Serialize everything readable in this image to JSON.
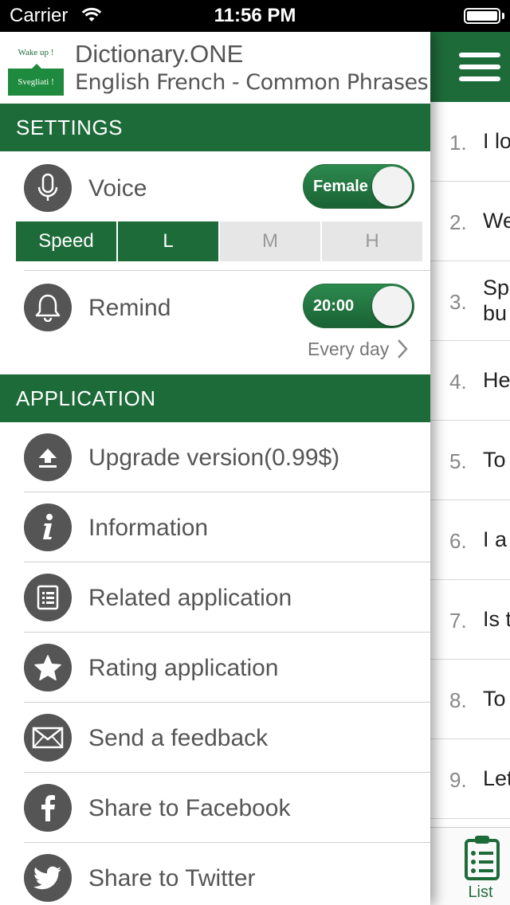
{
  "status_bar": {
    "carrier": "Carrier",
    "time": "11:56 PM"
  },
  "logo": {
    "top_text": "Wake up !",
    "bottom_text": "Svegliati !"
  },
  "header": {
    "title": "Dictionary.ONE",
    "subtitle": "English French - Common Phrases"
  },
  "settings": {
    "section_title": "SETTINGS",
    "voice": {
      "label": "Voice",
      "toggle_value": "Female",
      "icon": "microphone-icon"
    },
    "speed": {
      "label": "Speed",
      "options": [
        "L",
        "M",
        "H"
      ],
      "selected": "L"
    },
    "remind": {
      "label": "Remind",
      "toggle_value": "20:00",
      "repeat": "Every day",
      "icon": "bell-icon"
    }
  },
  "application": {
    "section_title": "APPLICATION",
    "items": [
      {
        "label": "Upgrade version(0.99$)",
        "icon": "upload-icon"
      },
      {
        "label": "Information",
        "icon": "info-icon"
      },
      {
        "label": "Related application",
        "icon": "list-icon"
      },
      {
        "label": "Rating application",
        "icon": "star-icon"
      },
      {
        "label": "Send a feedback",
        "icon": "envelope-icon"
      },
      {
        "label": "Share to Facebook",
        "icon": "facebook-icon"
      },
      {
        "label": "Share to Twitter",
        "icon": "twitter-icon"
      }
    ]
  },
  "list": {
    "rows": [
      {
        "num": "1.",
        "text": "I lo"
      },
      {
        "num": "2.",
        "text": "We"
      },
      {
        "num": "3.",
        "text": "Sp",
        "text2": "bu"
      },
      {
        "num": "4.",
        "text": "He"
      },
      {
        "num": "5.",
        "text": "To"
      },
      {
        "num": "6.",
        "text": "I a"
      },
      {
        "num": "7.",
        "text": "Is t"
      },
      {
        "num": "8.",
        "text": "To"
      },
      {
        "num": "9.",
        "text": "Let"
      }
    ]
  },
  "tabbar": {
    "list_label": "List"
  },
  "colors": {
    "brand_green": "#1e6b3a",
    "icon_gray": "#555555"
  }
}
